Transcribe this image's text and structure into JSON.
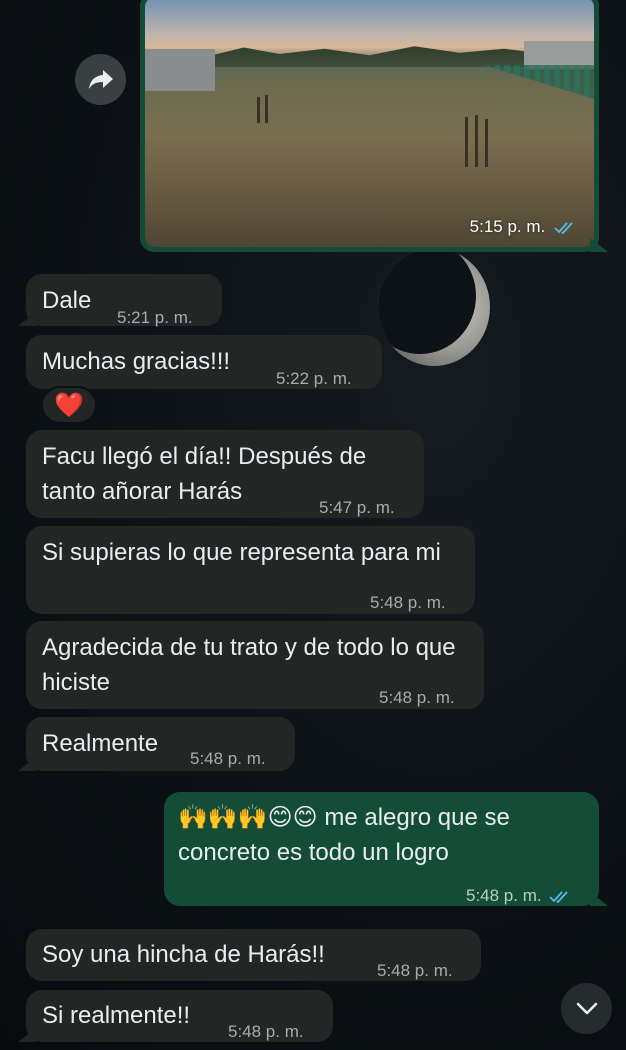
{
  "chat": {
    "photo_message": {
      "time": "5:15 p. m.",
      "status": "read",
      "tick_color": "#53bdeb"
    },
    "messages": [
      {
        "text": "Dale",
        "time": "5:21 p. m."
      },
      {
        "text": "Muchas gracias!!!",
        "time": "5:22 p. m.",
        "reaction": "❤️"
      },
      {
        "text": "Facu llegó el día!! Después de tanto añorar Harás",
        "time": "5:47 p. m."
      },
      {
        "text": "Si supieras lo que representa para mi",
        "time": "5:48 p. m."
      },
      {
        "text": "Agradecida de tu trato y de todo lo que hiciste",
        "time": "5:48 p. m."
      },
      {
        "text": "Realmente",
        "time": "5:48 p. m."
      },
      {
        "text": "🙌🙌🙌😊😊 me alegro que se concreto es todo un logro",
        "time": "5:48 p. m.",
        "outgoing": true,
        "status": "read"
      },
      {
        "text": "Soy una hincha de Harás!!",
        "time": "5:48 p. m."
      },
      {
        "text": "Si realmente!!",
        "time": "5:48 p. m."
      }
    ]
  },
  "icons": {
    "forward": "forward-arrow-icon",
    "scroll_down": "chevron-down-icon",
    "read_ticks": "double-check-icon"
  },
  "colors": {
    "incoming_bubble": "#242626",
    "outgoing_bubble": "#134d37",
    "background": "#0b1014",
    "read_ticks": "#53bdeb"
  }
}
